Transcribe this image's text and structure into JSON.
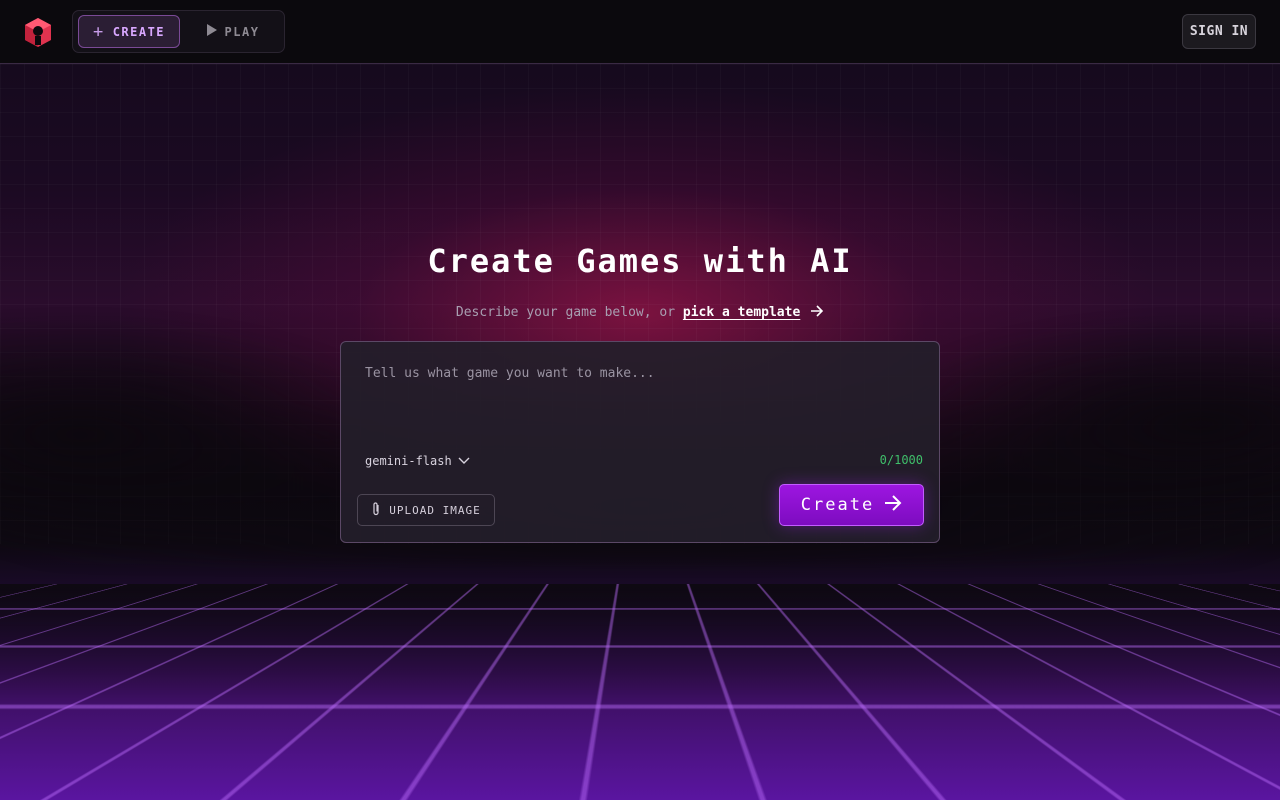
{
  "header": {
    "logo_icon": "cube-logo-icon",
    "nav": [
      {
        "label": "CREATE",
        "icon": "plus-icon",
        "active": true
      },
      {
        "label": "PLAY",
        "icon": "play-icon",
        "active": false
      }
    ],
    "sign_in_label": "SIGN IN"
  },
  "hero": {
    "title": "Create Games with AI",
    "subtitle_prefix": "Describe your game below, or",
    "template_link": "pick a template"
  },
  "composer": {
    "placeholder": "Tell us what game you want to make...",
    "value": "",
    "model": "gemini-flash",
    "char_count": "0/1000",
    "upload_label": "UPLOAD IMAGE",
    "create_label": "Create"
  },
  "colors": {
    "accent": "#9d16e0",
    "link": "#ffffff",
    "count": "#3fbf6a",
    "logo": "#e0334f"
  }
}
